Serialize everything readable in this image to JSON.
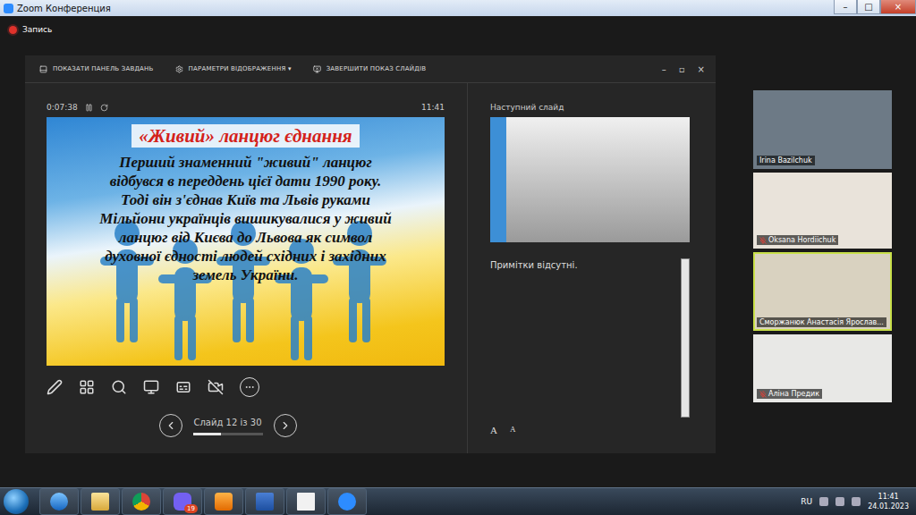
{
  "window": {
    "title": "Zoom Конференция",
    "controls": [
      "–",
      "□",
      "×"
    ]
  },
  "recording": {
    "label": "Запись",
    "on": true
  },
  "presenter": {
    "toolbar": [
      {
        "label": "ПОКАЗАТИ ПАНЕЛЬ ЗАВДАНЬ"
      },
      {
        "label": "ПАРАМЕТРИ ВІДОБРАЖЕННЯ ▾"
      },
      {
        "label": "ЗАВЕРШИТИ ПОКАЗ СЛАЙДІВ"
      }
    ],
    "window_controls": [
      "–",
      "▫",
      "×"
    ],
    "timer": "0:07:38",
    "clock": "11:41",
    "slide": {
      "title": "«Живий» ланцюг єднання",
      "body": [
        "Перший знаменний \"живий\" ланцюг",
        "відбувся в переддень цієї дати 1990 року.",
        "Тоді він з'єднав Київ та Львів руками",
        "Мільйони українців вишикувалися у живий",
        "ланцюг від Києва до Львова як символ",
        "духовної єдності людей східних і західних",
        "земель України."
      ]
    },
    "next_slide_label": "Наступний слайд",
    "notes": "Примітки відсутні.",
    "font_buttons": [
      "A",
      "A"
    ],
    "navigation": {
      "counter": "Слайд 12 із 30",
      "level": 0.4
    }
  },
  "participants": [
    {
      "name": "Irina Bazilchuk",
      "muted": false,
      "speaking": false
    },
    {
      "name": "Oksana Hordiichuk",
      "muted": true,
      "speaking": false
    },
    {
      "name": "Сморжанюк Анастасія Ярослав...",
      "muted": false,
      "speaking": true
    },
    {
      "name": "Аліна Предик",
      "muted": true,
      "speaking": false
    }
  ],
  "taskbar": {
    "apps": [
      {
        "kind": "ie"
      },
      {
        "kind": "folder"
      },
      {
        "kind": "chrome"
      },
      {
        "kind": "viber",
        "badge": "19"
      },
      {
        "kind": "player"
      },
      {
        "kind": "word"
      },
      {
        "kind": "file"
      },
      {
        "kind": "zoom"
      }
    ],
    "tray": {
      "lang": "RU",
      "time": "11:41",
      "date": "24.01.2023"
    }
  }
}
